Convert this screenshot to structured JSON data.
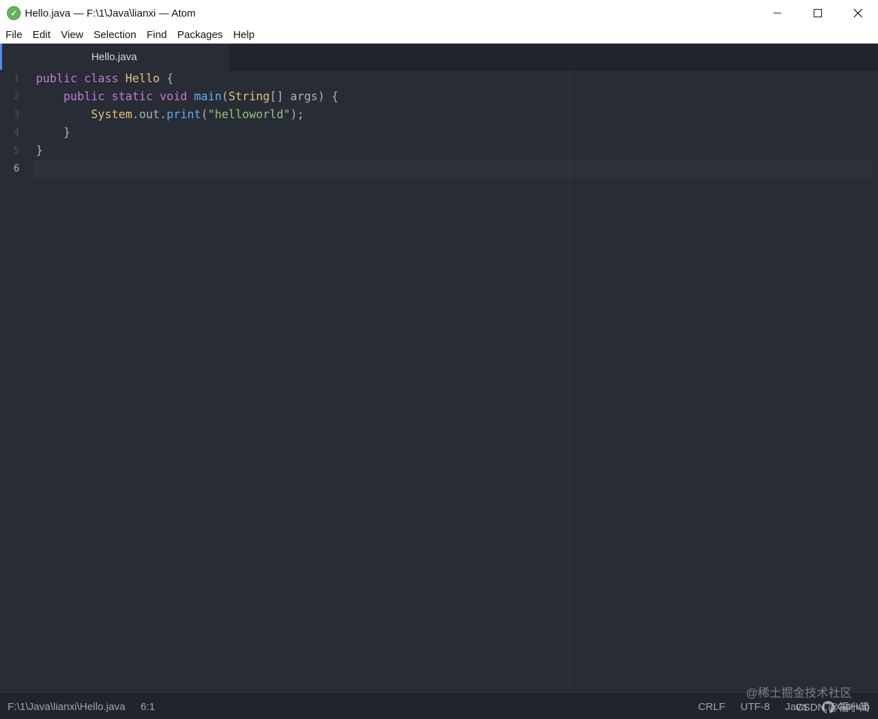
{
  "window": {
    "title": "Hello.java — F:\\1\\Java\\lianxi — Atom",
    "icon_glyph": "✓"
  },
  "menu": {
    "items": [
      "File",
      "Edit",
      "View",
      "Selection",
      "Find",
      "Packages",
      "Help"
    ]
  },
  "tabs": [
    {
      "label": "Hello.java",
      "active": true
    }
  ],
  "editor": {
    "line_numbers": [
      "1",
      "2",
      "3",
      "4",
      "5",
      "6"
    ],
    "active_line": "6",
    "code": {
      "l1": {
        "kw1": "public",
        "kw2": "class",
        "cls": "Hello",
        "rest": " {"
      },
      "l2": {
        "indent": "    ",
        "kw1": "public",
        "kw2": "static",
        "kw3": "void",
        "fn": "main",
        "p1": "(",
        "cls": "String",
        "rest": "[] args) {"
      },
      "l3": {
        "indent": "        ",
        "cls": "System",
        "p1": ".out.",
        "fn": "print",
        "p2": "(",
        "str": "\"helloworld\"",
        "rest": ");"
      },
      "l4": {
        "text": "    }"
      },
      "l5": {
        "text": "}"
      }
    },
    "syntax_colors": {
      "keyword": "#c678dd",
      "class": "#e5c07b",
      "function": "#61afef",
      "string": "#98c379",
      "plain": "#abb2bf"
    }
  },
  "status": {
    "path": "F:\\1\\Java\\lianxi\\Hello.java",
    "cursor": "6:1",
    "line_ending": "CRLF",
    "encoding": "UTF-8",
    "grammar": "Java",
    "github": "GitHub"
  },
  "watermarks": {
    "juejin": "@稀土掘金技术社区",
    "csdn": "CSDN @福小简"
  }
}
